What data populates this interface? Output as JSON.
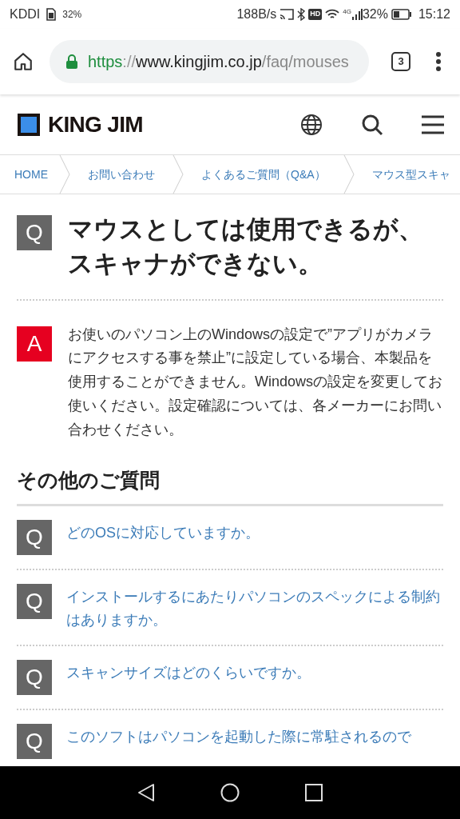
{
  "status_bar": {
    "carrier": "KDDI",
    "sim_battery": "32%",
    "speed": "188B/s",
    "hd": "HD",
    "network": "4G",
    "battery": "32%",
    "time": "15:12"
  },
  "browser": {
    "url_scheme": "https",
    "url_sep": "://",
    "url_host": "www.kingjim.co.jp",
    "url_path": "/faq/mouses",
    "tab_count": "3"
  },
  "site": {
    "logo": "KING JIM"
  },
  "breadcrumbs": [
    "HOME",
    "お問い合わせ",
    "よくあるご質問（Q&A）",
    "マウス型スキャ"
  ],
  "question": {
    "mark": "Q",
    "title": "マウスとしては使用できるが、スキャナができない。"
  },
  "answer": {
    "mark": "A",
    "text": "お使いのパソコン上のWindowsの設定で”アプリがカメラにアクセスする事を禁止”に設定している場合、本製品を使用することができません。Windowsの設定を変更してお使いください。設定確認については、各メーカーにお問い合わせください。"
  },
  "other": {
    "heading": "その他のご質問",
    "items": [
      {
        "mark": "Q",
        "text": "どのOSに対応していますか。"
      },
      {
        "mark": "Q",
        "text": "インストールするにあたりパソコンのスペックによる制約はありますか。"
      },
      {
        "mark": "Q",
        "text": "スキャンサイズはどのくらいですか。"
      },
      {
        "mark": "Q",
        "text": "このソフトはパソコンを起動した際に常駐されるので"
      }
    ]
  }
}
